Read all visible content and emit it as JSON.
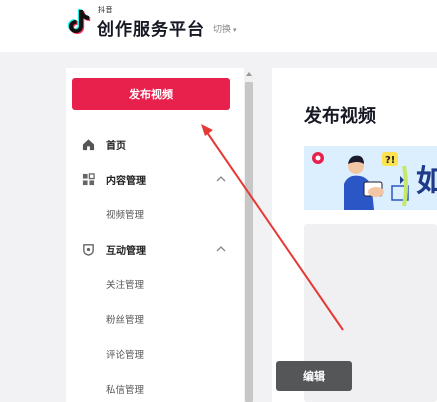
{
  "header": {
    "logo_small": "抖音",
    "logo_title": "创作服务平台",
    "switch_label": "切换"
  },
  "sidebar": {
    "publish_button": "发布视频",
    "items": [
      {
        "label": "首页",
        "icon": "home-icon"
      },
      {
        "label": "内容管理",
        "icon": "grid-icon"
      },
      {
        "label": "视频管理"
      },
      {
        "label": "互动管理",
        "icon": "interaction-icon"
      },
      {
        "label": "关注管理"
      },
      {
        "label": "粉丝管理"
      },
      {
        "label": "评论管理"
      },
      {
        "label": "私信管理"
      }
    ]
  },
  "main": {
    "page_title": "发布视频",
    "banner_text": "如"
  },
  "edit_button": "编辑",
  "colors": {
    "brand": "#e8214c",
    "annotation_arrow": "#e53935"
  }
}
